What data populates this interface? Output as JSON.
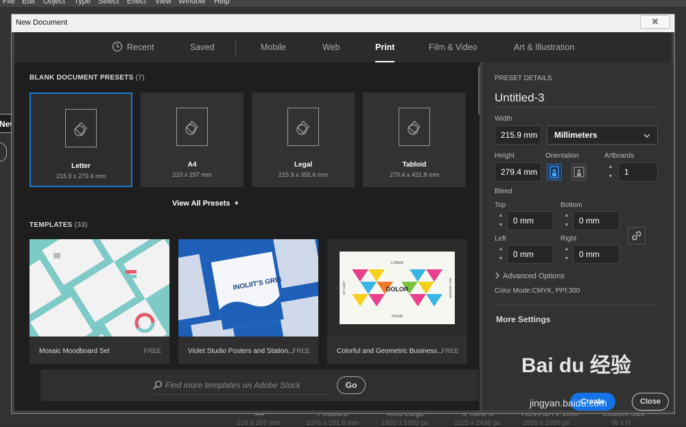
{
  "menubar": [
    "File",
    "Edit",
    "Object",
    "Type",
    "Select",
    "Effect",
    "View",
    "Window",
    "Help"
  ],
  "background": {
    "new_button": "New",
    "footer_items": [
      {
        "name": "A4",
        "dim": "210 x 297 mm"
      },
      {
        "name": "Postcard",
        "dim": "1076 x 101.6 mm"
      },
      {
        "name": "Web-Large",
        "dim": "1920 x 1080 px"
      },
      {
        "name": "iPhone X",
        "dim": "1125 x 2436 px"
      },
      {
        "name": "HDV/HDTV 1080",
        "dim": "1920 x 1080 px"
      },
      {
        "name": "Custom Size",
        "dim": "W x H"
      }
    ]
  },
  "dialog": {
    "title": "New Document",
    "close_glyph": "✖"
  },
  "tabs": [
    {
      "label": "Recent",
      "active": false
    },
    {
      "label": "Saved",
      "active": false
    },
    {
      "label": "Mobile",
      "active": false
    },
    {
      "label": "Web",
      "active": false
    },
    {
      "label": "Print",
      "active": true
    },
    {
      "label": "Film & Video",
      "active": false
    },
    {
      "label": "Art & Illustration",
      "active": false
    }
  ],
  "presets_section": {
    "title": "BLANK DOCUMENT PRESETS",
    "count": "(7)"
  },
  "presets": [
    {
      "name": "Letter",
      "dim": "215.9 x 279.4 mm",
      "selected": true
    },
    {
      "name": "A4",
      "dim": "210 x 297 mm",
      "selected": false
    },
    {
      "name": "Legal",
      "dim": "215.9 x 355.6 mm",
      "selected": false
    },
    {
      "name": "Tabloid",
      "dim": "279.4 x 431.8 mm",
      "selected": false
    }
  ],
  "view_all": "View All Presets",
  "view_all_plus": "+",
  "templates_section": {
    "title": "TEMPLATES",
    "count": "(33)"
  },
  "templates": [
    {
      "name": "Mosaic Moodboard Set",
      "badge": "FREE"
    },
    {
      "name": "Violet Studio Posters and Station...",
      "badge": "FREE",
      "poster_text": "INOLIIT'S GRIS"
    },
    {
      "name": "Colorful and Geometric Business...",
      "badge": "FREE",
      "card_words": [
        "LOREM",
        "DOLOR",
        "IPSUM",
        "SIT AMET",
        "SED SEMPER"
      ]
    }
  ],
  "search": {
    "placeholder": "Find more templates on Adobe Stock",
    "go": "Go"
  },
  "details": {
    "header": "PRESET DETAILS",
    "doc_name": "Untitled-3",
    "width_label": "Width",
    "width_value": "215.9 mm",
    "units": "Millimeters",
    "height_label": "Height",
    "height_value": "279.4 mm",
    "orientation_label": "Orientation",
    "artboards_label": "Artboards",
    "artboards_value": "1",
    "bleed_label": "Bleed",
    "top_label": "Top",
    "top_value": "0 mm",
    "bottom_label": "Bottom",
    "bottom_value": "0 mm",
    "left_label": "Left",
    "left_value": "0 mm",
    "right_label": "Right",
    "right_value": "0 mm",
    "advanced": "Advanced Options",
    "color_mode": "Color Mode:CMYK, PPI:300",
    "more_settings": "More Settings",
    "create": "Create",
    "close": "Close"
  },
  "watermark": {
    "brand": "Bai du 经验",
    "url": "jingyan.baidu.com"
  },
  "colors": {
    "accent": "#1473e6",
    "selected_border": "#1e78d8",
    "panel": "#1e1e1e",
    "side": "#323232"
  }
}
